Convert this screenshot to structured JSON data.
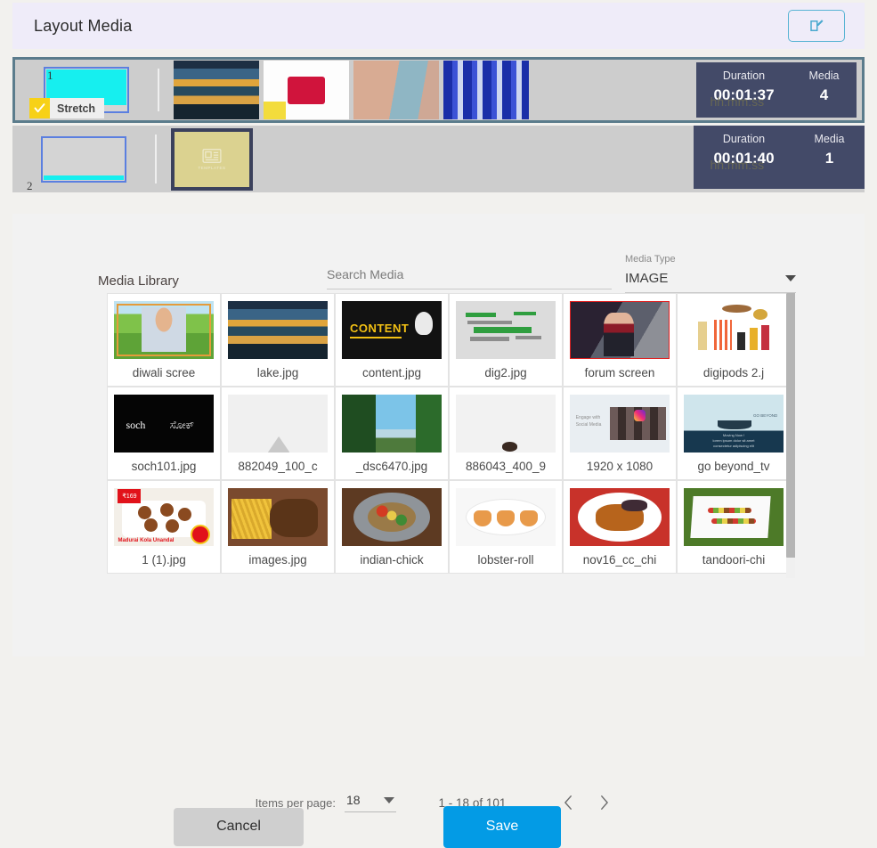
{
  "header": {
    "title": "Layout Media",
    "edit_icon": "edit-square-pencil-icon"
  },
  "timeline": {
    "rows": [
      {
        "index_label": "1",
        "selected": true,
        "stretch": {
          "label": "Stretch",
          "checked": true,
          "icon": "check-icon"
        },
        "thumbs": [
          "lake-thumb",
          "gift-box-thumb",
          "woman-thumb",
          "blue-lights-thumb"
        ],
        "duration_label": "Duration",
        "duration_value": "00:01:37",
        "duration_hint": "hh:mm:ss",
        "media_label": "Media",
        "media_value": "4"
      },
      {
        "index_label": "2",
        "selected": false,
        "thumbs": [
          "templates-placeholder-thumb"
        ],
        "duration_label": "Duration",
        "duration_value": "00:01:40",
        "duration_hint": "hh:mm:ss",
        "media_label": "Media",
        "media_value": "1"
      }
    ]
  },
  "library": {
    "title": "Media Library",
    "search": {
      "placeholder": "Search Media",
      "value": ""
    },
    "media_type": {
      "label": "Media Type",
      "value": "IMAGE",
      "icon": "chevron-down-icon"
    },
    "items": [
      {
        "name": "diwali scree",
        "art": "art-diwali"
      },
      {
        "name": "lake.jpg",
        "art": "art-lake"
      },
      {
        "name": "content.jpg",
        "art": "art-content"
      },
      {
        "name": "dig2.jpg",
        "art": "art-dig2"
      },
      {
        "name": "forum screen",
        "art": "art-forum"
      },
      {
        "name": "digipods 2.j",
        "art": "art-digipods"
      },
      {
        "name": "soch101.jpg",
        "art": "art-soch"
      },
      {
        "name": "882049_100_c",
        "art": "art-882"
      },
      {
        "name": "_dsc6470.jpg",
        "art": "art-dsc"
      },
      {
        "name": "886043_400_9",
        "art": "art-886"
      },
      {
        "name": "1920 x 1080",
        "art": "art-1920"
      },
      {
        "name": "go beyond_tv",
        "art": "art-gobeyond"
      },
      {
        "name": "1 (1).jpg",
        "art": "art-food1"
      },
      {
        "name": "images.jpg",
        "art": "art-images"
      },
      {
        "name": "indian-chick",
        "art": "art-indian"
      },
      {
        "name": "lobster-roll",
        "art": "art-lobster"
      },
      {
        "name": "nov16_cc_chi",
        "art": "art-nov"
      },
      {
        "name": "tandoori-chi",
        "art": "art-tandoori"
      }
    ]
  },
  "paginator": {
    "items_per_page_label": "Items per page:",
    "items_per_page_value": "18",
    "range": "1 - 18 of 101",
    "prev_icon": "chevron-left-icon",
    "next_icon": "chevron-right-icon"
  },
  "footer": {
    "cancel_label": "Cancel",
    "save_label": "Save"
  },
  "colors": {
    "accent_blue": "#039be5",
    "title_bg": "#efecf9",
    "row_selected_border": "#5b7c8c",
    "stats_bg": "#434a68",
    "cyan": "#16efef",
    "check_yellow": "#f7d117"
  }
}
